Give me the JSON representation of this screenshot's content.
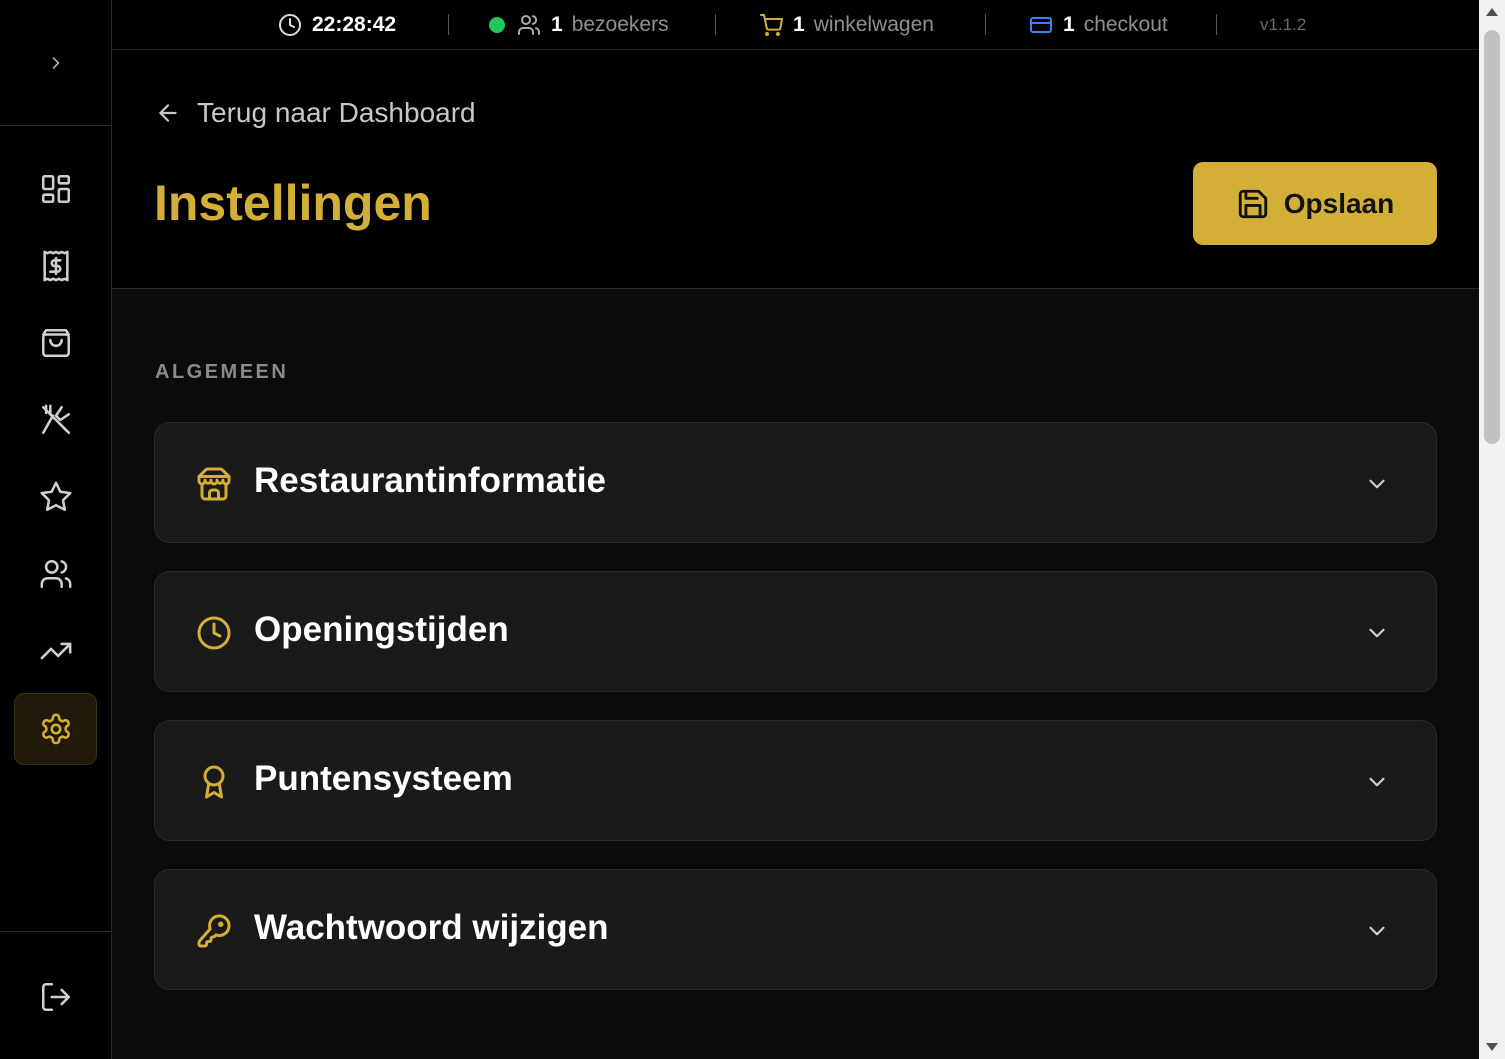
{
  "topbar": {
    "time": "22:28:42",
    "visitors_count": "1",
    "visitors_label": "bezoekers",
    "cart_count": "1",
    "cart_label": "winkelwagen",
    "checkout_count": "1",
    "checkout_label": "checkout",
    "version": "v1.1.2"
  },
  "sidebar": {
    "items": [
      {
        "icon": "dashboard-grid-icon",
        "active": false
      },
      {
        "icon": "receipt-dollar-icon",
        "active": false
      },
      {
        "icon": "shopping-bag-icon",
        "active": false
      },
      {
        "icon": "utensils-off-icon",
        "active": false
      },
      {
        "icon": "star-icon",
        "active": false
      },
      {
        "icon": "users-icon",
        "active": false
      },
      {
        "icon": "trending-up-icon",
        "active": false
      },
      {
        "icon": "gear-icon",
        "active": true
      }
    ],
    "logout_icon": "logout-icon"
  },
  "header": {
    "back_label": "Terug naar Dashboard",
    "title": "Instellingen",
    "save_label": "Opslaan"
  },
  "section": {
    "label": "ALGEMEEN",
    "cards": [
      {
        "label": "Restaurantinformatie",
        "icon": "store-icon"
      },
      {
        "label": "Openingstijden",
        "icon": "clock-icon"
      },
      {
        "label": "Puntensysteem",
        "icon": "award-icon"
      },
      {
        "label": "Wachtwoord wijzigen",
        "icon": "key-icon"
      }
    ]
  },
  "colors": {
    "accent": "#d4af37",
    "status_online": "#22c55e",
    "cart_icon": "#d4af37",
    "checkout_icon": "#3b82f6",
    "background": "#000000",
    "card": "#1a1a1a"
  }
}
